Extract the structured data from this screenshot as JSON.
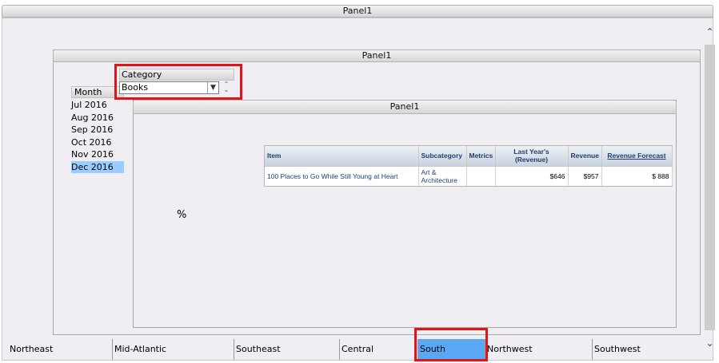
{
  "outer_panel": {
    "title": "Panel1"
  },
  "mid_panel": {
    "title": "Panel1"
  },
  "inner_panel": {
    "title": "Panel1"
  },
  "month": {
    "header": "Month",
    "items": [
      "Jul 2016",
      "Aug 2016",
      "Sep 2016",
      "Oct 2016",
      "Nov 2016",
      "Dec 2016"
    ],
    "selected": "Dec 2016"
  },
  "category": {
    "header": "Category",
    "value": "Books",
    "arrow_icon": "chevron-down-icon",
    "spinner_icon": "spinner-icon"
  },
  "grid": {
    "columns": [
      "Item",
      "Subcategory",
      "Metrics",
      "Last Year's (Revenue)",
      "Revenue",
      "Revenue Forecast"
    ],
    "rows": [
      [
        "100 Places to Go While Still Young at Heart",
        "Art & Architecture",
        "",
        "$646",
        "$957",
        "$ 888"
      ]
    ]
  },
  "percent_label": "%",
  "regions": {
    "tabs": [
      "Northeast",
      "Mid-Atlantic",
      "Southeast",
      "Central",
      "South",
      "Northwest",
      "Southwest"
    ],
    "selected": "South"
  },
  "colors": {
    "highlight_red": "#e0151a",
    "selected_blue": "#5aa8f4",
    "month_selected": "#99ccff"
  }
}
